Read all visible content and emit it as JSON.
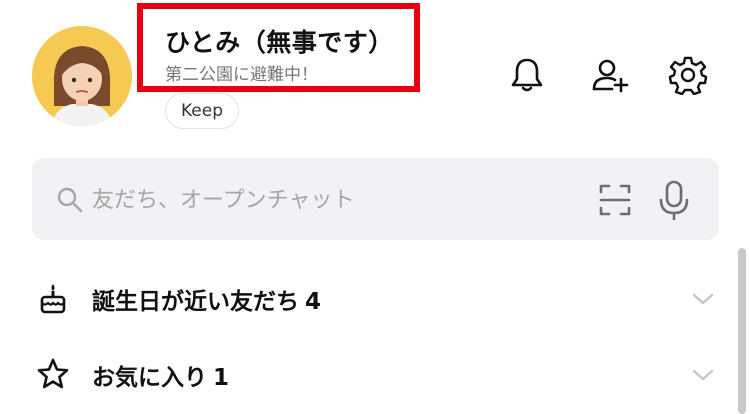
{
  "profile": {
    "name": "ひとみ（無事です）",
    "status_message": "第二公園に避難中！",
    "keep_label": "Keep",
    "highlight_color": "#e60012",
    "avatar_bg_color": "#f6ca52"
  },
  "header_icons": [
    "bell-icon",
    "add-friend-icon",
    "gear-icon"
  ],
  "search": {
    "placeholder": "友だち、オープンチャット",
    "icons": [
      "search-icon",
      "scan-icon",
      "microphone-icon"
    ]
  },
  "sections": [
    {
      "icon": "birthday-cake-icon",
      "label": "誕生日が近い友だち",
      "count": "4"
    },
    {
      "icon": "star-icon",
      "label": "お気に入り",
      "count": "1"
    }
  ]
}
